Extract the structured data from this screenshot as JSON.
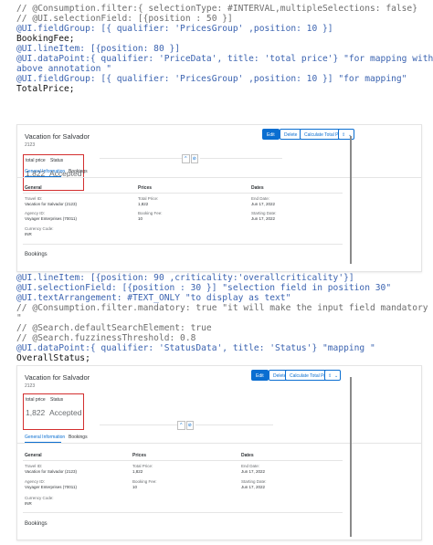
{
  "code_block_1": [
    {
      "text": "// @Consumption.filter:{ selectionType: #INTERVAL,multipleSelections: false}",
      "color": "gray"
    },
    {
      "text": "// @UI.selectionField: [{position : 50 }]",
      "color": "gray"
    },
    {
      "text": "@UI.fieldGroup: [{ qualifier: 'PricesGroup' ,position: 10 }]",
      "color": "blue"
    },
    {
      "text": "BookingFee;",
      "color": "black"
    },
    {
      "text": "@UI.lineItem: [{position: 80 }]",
      "color": "blue"
    },
    {
      "text": "@UI.dataPoint:{ qualifier: 'PriceData', title: 'total price'} \"for mapping with",
      "color": "blue"
    },
    {
      "text": "above annotation \"",
      "color": "blue"
    },
    {
      "text": "@UI.fieldGroup: [{ qualifier: 'PricesGroup' ,position: 10 }] \"for mapping\"",
      "color": "blue"
    },
    {
      "text": "TotalPrice;",
      "color": "black"
    }
  ],
  "code_block_2": [
    {
      "text": "@UI.lineItem: [{position: 90 ,criticality:'overallcriticality'}]",
      "color": "blue"
    },
    {
      "text": "@UI.selectionField: [{position : 30 }] \"selection field in position 30\"",
      "color": "blue"
    },
    {
      "text": "@UI.textArrangement: #TEXT_ONLY \"to display as text\"",
      "color": "blue"
    },
    {
      "text": "// @Consumption.filter.mandatory: true \"it will make the input field mandatory",
      "color": "gray"
    },
    {
      "text": "\"",
      "color": "gray"
    },
    {
      "text": "// @Search.defaultSearchElement: true",
      "color": "gray"
    },
    {
      "text": "// @Search.fuzzinessThreshold: 0.8",
      "color": "gray"
    },
    {
      "text": "@UI.dataPoint:{ qualifier: 'StatusData', title: 'Status'} \"mapping \"",
      "color": "blue"
    },
    {
      "text": "OverallStatus;",
      "color": "black"
    }
  ],
  "object_page": {
    "title": "Vacation for Salvador",
    "subtitle": "2123",
    "buttons": {
      "edit": "Edit",
      "delete": "Delete",
      "calculate": "Calculate Total Price",
      "share_icon": "share-icon",
      "chevron_icon": "chevron-down-icon"
    },
    "kpi": {
      "total_price_label": "total price",
      "total_price_value": "1,822",
      "status_label": "Status",
      "status_value": "Accepted"
    },
    "tabs": {
      "general": "General Information",
      "bookings": "Bookings"
    },
    "sections": {
      "general": "General",
      "prices": "Prices",
      "dates": "Dates"
    },
    "fields": {
      "travel_id_label": "Travel ID:",
      "travel_id_value": "Vacation for Salvador (2123)",
      "agency_id_label": "Agency ID:",
      "agency_id_value": "Voyager Enterprises (70011)",
      "currency_label": "Currency Code:",
      "currency_value": "INR",
      "total_price_label": "Total Price:",
      "total_price_value": "1,822",
      "booking_fee_label": "Booking Fee:",
      "booking_fee_value": "10",
      "end_date_label": "End Date:",
      "end_date_value": "Jun 17, 2022",
      "start_date_label": "Starting Date:",
      "start_date_value": "Jun 17, 2022"
    },
    "bookings_title": "Bookings"
  },
  "colors": {
    "accent": "#0a6ed1",
    "highlight_box": "#d32f2f",
    "code_blue": "#3b63b0",
    "code_gray": "#6d6d6d"
  }
}
